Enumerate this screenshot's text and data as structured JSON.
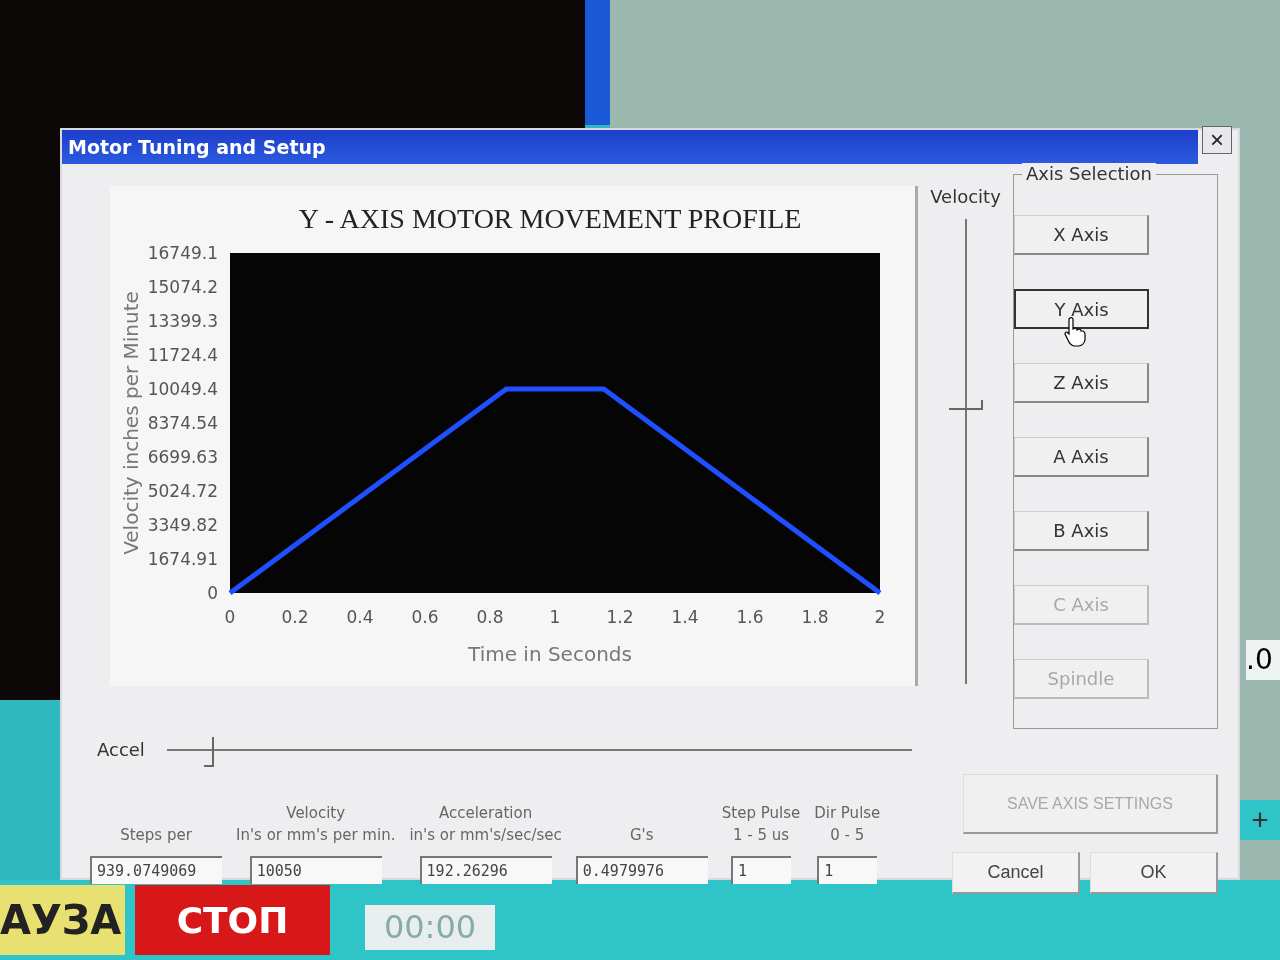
{
  "window": {
    "title": "Motor Tuning and Setup",
    "close": "×"
  },
  "chart": {
    "chart_data": {
      "type": "line",
      "title": "Y - AXIS MOTOR MOVEMENT PROFILE",
      "xlabel": "Time in Seconds",
      "ylabel": "Velocity inches per Minute",
      "x": [
        0,
        0.85,
        1.15,
        2
      ],
      "series": [
        {
          "color": "#1f4fff",
          "values": [
            0,
            10050,
            10050,
            0
          ]
        }
      ],
      "xlim": [
        0,
        2
      ],
      "ylim": [
        0,
        16749.1
      ],
      "xticks": [
        0,
        0.2,
        0.4,
        0.6,
        0.8,
        1,
        1.2,
        1.4,
        1.6,
        1.8,
        2
      ],
      "yticks": [
        0,
        1674.91,
        3349.82,
        5024.72,
        6699.63,
        8374.54,
        10049.4,
        11724.4,
        13399.3,
        15074.2,
        16749.1
      ]
    }
  },
  "velocity_slider": {
    "label": "Velocity",
    "level": 0.59
  },
  "axis_selection": {
    "title": "Axis Selection",
    "buttons": [
      {
        "label": "X Axis",
        "selected": false,
        "disabled": false
      },
      {
        "label": "Y Axis",
        "selected": true,
        "disabled": false
      },
      {
        "label": "Z Axis",
        "selected": false,
        "disabled": false
      },
      {
        "label": "A Axis",
        "selected": false,
        "disabled": false
      },
      {
        "label": "B Axis",
        "selected": false,
        "disabled": false
      },
      {
        "label": "C Axis",
        "selected": false,
        "disabled": true
      },
      {
        "label": "Spindle",
        "selected": false,
        "disabled": true
      }
    ]
  },
  "accel_slider": {
    "label": "Accel",
    "level": 0.05
  },
  "fields": [
    {
      "lines": [
        "Steps per"
      ],
      "value": "939.0749069"
    },
    {
      "lines": [
        "Velocity",
        "In's or mm's per min."
      ],
      "value": "10050"
    },
    {
      "lines": [
        "Acceleration",
        "in's or mm's/sec/sec"
      ],
      "value": "192.26296"
    },
    {
      "lines": [
        "G's"
      ],
      "value": "0.4979976"
    },
    {
      "lines": [
        "Step Pulse",
        "1 - 5 us"
      ],
      "value": "1"
    },
    {
      "lines": [
        "Dir Pulse",
        "0 - 5"
      ],
      "value": "1"
    }
  ],
  "save_button": {
    "label": "SAVE AXIS SETTINGS",
    "disabled": true
  },
  "buttons": [
    {
      "label": "Cancel"
    },
    {
      "label": "OK"
    }
  ],
  "background": {
    "pause_label": "АУЗА",
    "stop_label": "СТОП",
    "timer": "00:00",
    "right_value": ".0",
    "plus": "+"
  }
}
